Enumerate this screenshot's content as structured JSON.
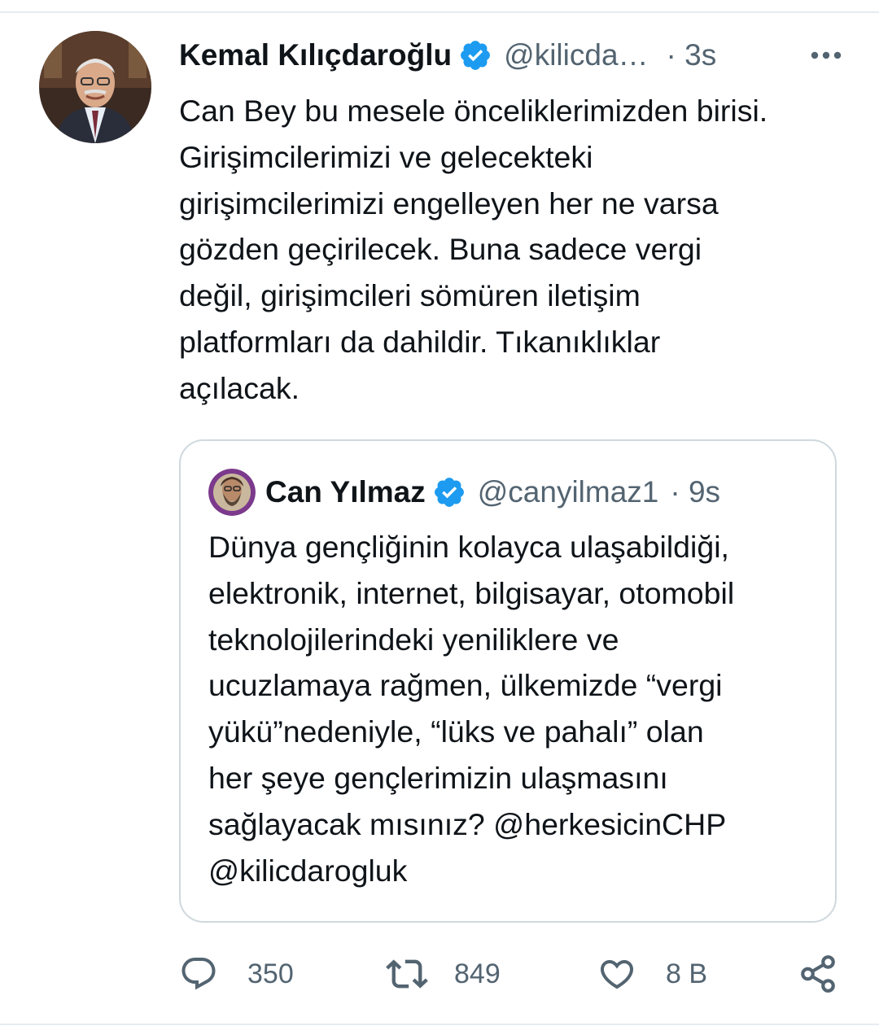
{
  "tweet": {
    "author_name": "Kemal Kılıçdaroğlu",
    "author_handle": "@kilicda…",
    "time": "· 3s",
    "text": "Can Bey bu mesele önceliklerimizden birisi.\nGirişimcilerimizi ve gelecekteki\ngirişimcilerimizi engelleyen her ne varsa\ngözden geçirilecek. Buna sadece vergi\ndeğil, girişimcileri sömüren iletişim\nplatformları da dahildir. Tıkanıklıklar\naçılacak."
  },
  "quote": {
    "author_name": "Can Yılmaz",
    "author_handle": "@canyilmaz1",
    "time": "· 9s",
    "text": "Dünya gençliğinin kolayca ulaşabildiği,\nelektronik, internet, bilgisayar, otomobil\nteknolojilerindeki yeniliklere ve\nucuzlamaya rağmen, ülkemizde “vergi\nyükü”nedeniyle,  “lüks ve pahalı” olan\nher şeye gençlerimizin ulaşmasını\nsağlayacak mısınız? @herkesicinCHP\n@kilicdarogluk"
  },
  "actions": {
    "reply_count": "350",
    "retweet_count": "849",
    "like_count": "8 B"
  },
  "icons": {
    "verified": "verified-badge-icon",
    "more": "more-options-icon",
    "reply": "reply-icon",
    "retweet": "retweet-icon",
    "like": "heart-icon",
    "share": "share-icon"
  },
  "colors": {
    "verified_blue": "#1d9bf0",
    "secondary_text": "#536471",
    "primary_text": "#0f1419",
    "border": "#cfd9de"
  }
}
